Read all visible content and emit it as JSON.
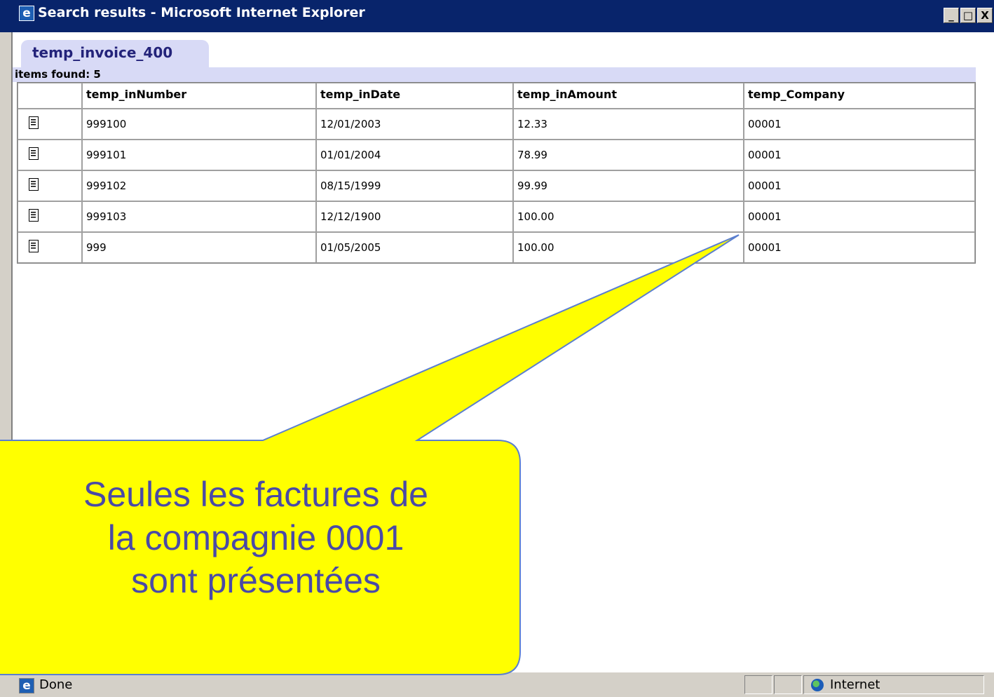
{
  "window": {
    "title": "Search results - Microsoft Internet Explorer",
    "controls": [
      "_",
      "□",
      "X"
    ]
  },
  "tab": {
    "label": "temp_invoice_400"
  },
  "summary": {
    "items_found": "items found: 5"
  },
  "table": {
    "columns": [
      "",
      "temp_inNumber",
      "temp_inDate",
      "temp_inAmount",
      "temp_Company"
    ],
    "rows": [
      [
        "999100",
        "12/01/2003",
        "12.33",
        "00001"
      ],
      [
        "999101",
        "01/01/2004",
        "78.99",
        "00001"
      ],
      [
        "999102",
        "08/15/1999",
        "99.99",
        "00001"
      ],
      [
        "999103",
        "12/12/1900",
        "100.00",
        "00001"
      ],
      [
        "999",
        "01/05/2005",
        "100.00",
        "00001"
      ]
    ]
  },
  "callout": {
    "lines": [
      "Seules les factures de",
      "la compagnie 0001",
      "sont présentées"
    ],
    "fill": "#ffff00",
    "text_color": "#4a4aa6"
  },
  "status": {
    "text": "Done",
    "zone": "Internet"
  },
  "colors": {
    "titlebar": "#08246b",
    "tab": "#d8daf6",
    "chrome": "#d4d0c8"
  }
}
